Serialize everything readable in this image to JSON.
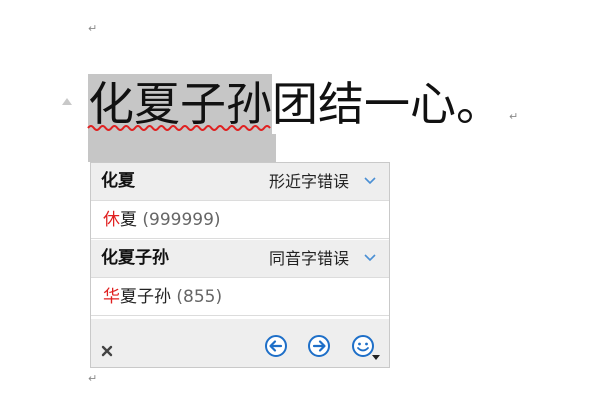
{
  "document": {
    "para_mark": "↵",
    "sentence_selected": "化夏子孙",
    "sentence_rest": "团结一心。"
  },
  "spell_panel": {
    "groups": [
      {
        "title": "化夏",
        "error_type": "形近字错误",
        "suggestion": {
          "replaced": "休",
          "rest": "夏",
          "count": "(999999)"
        }
      },
      {
        "title": "化夏子孙",
        "error_type": "同音字错误",
        "suggestion": {
          "replaced": "华",
          "rest": "夏子孙",
          "count": "(855)"
        }
      }
    ],
    "footer_icons": [
      "close-icon",
      "prev-arrow-icon",
      "next-arrow-icon",
      "smiley-menu-icon"
    ]
  },
  "colors": {
    "selection": "#c6c6c6",
    "squiggle": "#e02020",
    "correction": "#e02020",
    "accent": "#1e6fc8",
    "panel_header": "#eeeeee"
  }
}
